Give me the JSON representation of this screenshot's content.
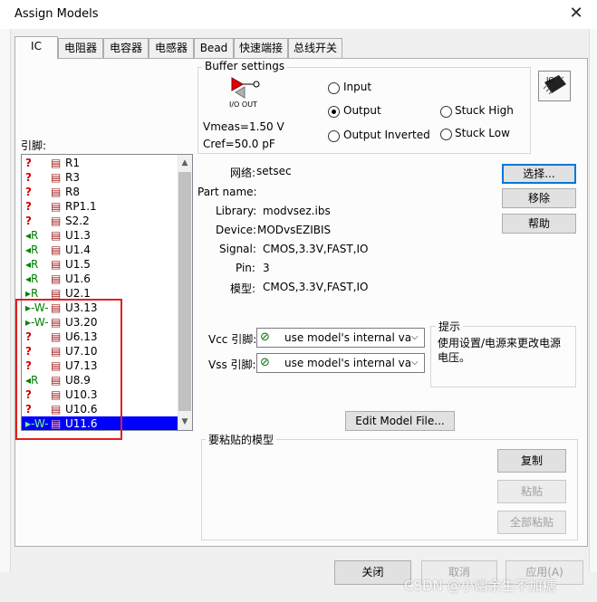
{
  "window": {
    "title": "Assign Models",
    "close_glyph": "✕"
  },
  "tabs": [
    "IC",
    "电阻器",
    "电容器",
    "电感器",
    "Bead",
    "快速端接",
    "总线开关"
  ],
  "buffer": {
    "title": "Buffer settings",
    "icon_label": "I/O  OUT",
    "vmeas": "Vmeas=1.50 V",
    "cref": "Cref=50.0 pF",
    "radios": [
      {
        "label": "Input",
        "checked": false
      },
      {
        "label": "Output",
        "checked": true
      },
      {
        "label": "Output Inverted",
        "checked": false
      },
      {
        "label": "Stuck High",
        "checked": false
      },
      {
        "label": "Stuck Low",
        "checked": false
      }
    ]
  },
  "pins": {
    "label": "引脚:",
    "items": [
      {
        "icon": "question-icon",
        "label": "R1",
        "glyph": "?",
        "color": "#d40000"
      },
      {
        "icon": "question-icon",
        "label": "R3",
        "glyph": "?",
        "color": "#d40000"
      },
      {
        "icon": "question-icon",
        "label": "R8",
        "glyph": "?",
        "color": "#d40000"
      },
      {
        "icon": "question-icon",
        "label": "RP1.1",
        "glyph": "?",
        "color": "#d40000"
      },
      {
        "icon": "question-icon",
        "label": "S2.2",
        "glyph": "?",
        "color": "#d40000"
      },
      {
        "icon": "receiver-icon",
        "label": "U1.3",
        "glyph": "◂R",
        "color": "#008000"
      },
      {
        "icon": "receiver-icon",
        "label": "U1.4",
        "glyph": "◂R",
        "color": "#008000"
      },
      {
        "icon": "receiver-icon",
        "label": "U1.5",
        "glyph": "◂R",
        "color": "#008000"
      },
      {
        "icon": "receiver-icon",
        "label": "U1.6",
        "glyph": "◂R",
        "color": "#008000"
      },
      {
        "icon": "driver-icon",
        "label": "U2.1",
        "glyph": "▸R",
        "color": "#008000"
      },
      {
        "icon": "driver-resistor-icon",
        "label": "U3.13",
        "glyph": "▸-W-",
        "color": "#008000"
      },
      {
        "icon": "driver-resistor-icon",
        "label": "U3.20",
        "glyph": "▸-W-",
        "color": "#008000"
      },
      {
        "icon": "question-icon",
        "label": "U6.13",
        "glyph": "?",
        "color": "#d40000"
      },
      {
        "icon": "question-icon",
        "label": "U7.10",
        "glyph": "?",
        "color": "#d40000"
      },
      {
        "icon": "question-icon",
        "label": "U7.13",
        "glyph": "?",
        "color": "#d40000"
      },
      {
        "icon": "receiver-icon",
        "label": "U8.9",
        "glyph": "◂R",
        "color": "#008000"
      },
      {
        "icon": "question-icon",
        "label": "U10.3",
        "glyph": "?",
        "color": "#d40000"
      },
      {
        "icon": "question-icon",
        "label": "U10.6",
        "glyph": "?",
        "color": "#d40000"
      },
      {
        "icon": "driver-resistor-icon",
        "label": "U11.6",
        "glyph": "▸-W-",
        "color": "#008000"
      }
    ],
    "selected_index": 18
  },
  "info": {
    "net_label": "网络:",
    "net_value": "setsec",
    "part_label": "Part name:",
    "part_value": "",
    "library_label": "Library:",
    "library_value": "modvsez.ibs",
    "device_label": "Device:",
    "device_value": "MODvsEZIBIS",
    "signal_label": "Signal:",
    "signal_value": "CMOS,3.3V,FAST,IO",
    "pin_label": "Pin:",
    "pin_value": "3",
    "model_label": "模型:",
    "model_value": "CMOS,3.3V,FAST,IO"
  },
  "side_buttons": {
    "select": "选择...",
    "remove": "移除",
    "help": "帮助"
  },
  "supply": {
    "vcc_label": "Vcc 引脚:",
    "vcc_value": "use model's internal va",
    "vss_label": "Vss 引脚:",
    "vss_value": "use model's internal va"
  },
  "hint": {
    "title": "提示",
    "text": "使用设置/电源来更改电源电压。"
  },
  "edit_model_button": "Edit Model File...",
  "paste_group": {
    "title": "要粘贴的模型",
    "copy": "复制",
    "paste": "粘贴",
    "paste_all": "全部粘贴"
  },
  "footer": {
    "close": "关闭",
    "cancel": "取消",
    "apply": "应用(A)"
  },
  "watermark": "CSDN @小幽余生不加糖"
}
